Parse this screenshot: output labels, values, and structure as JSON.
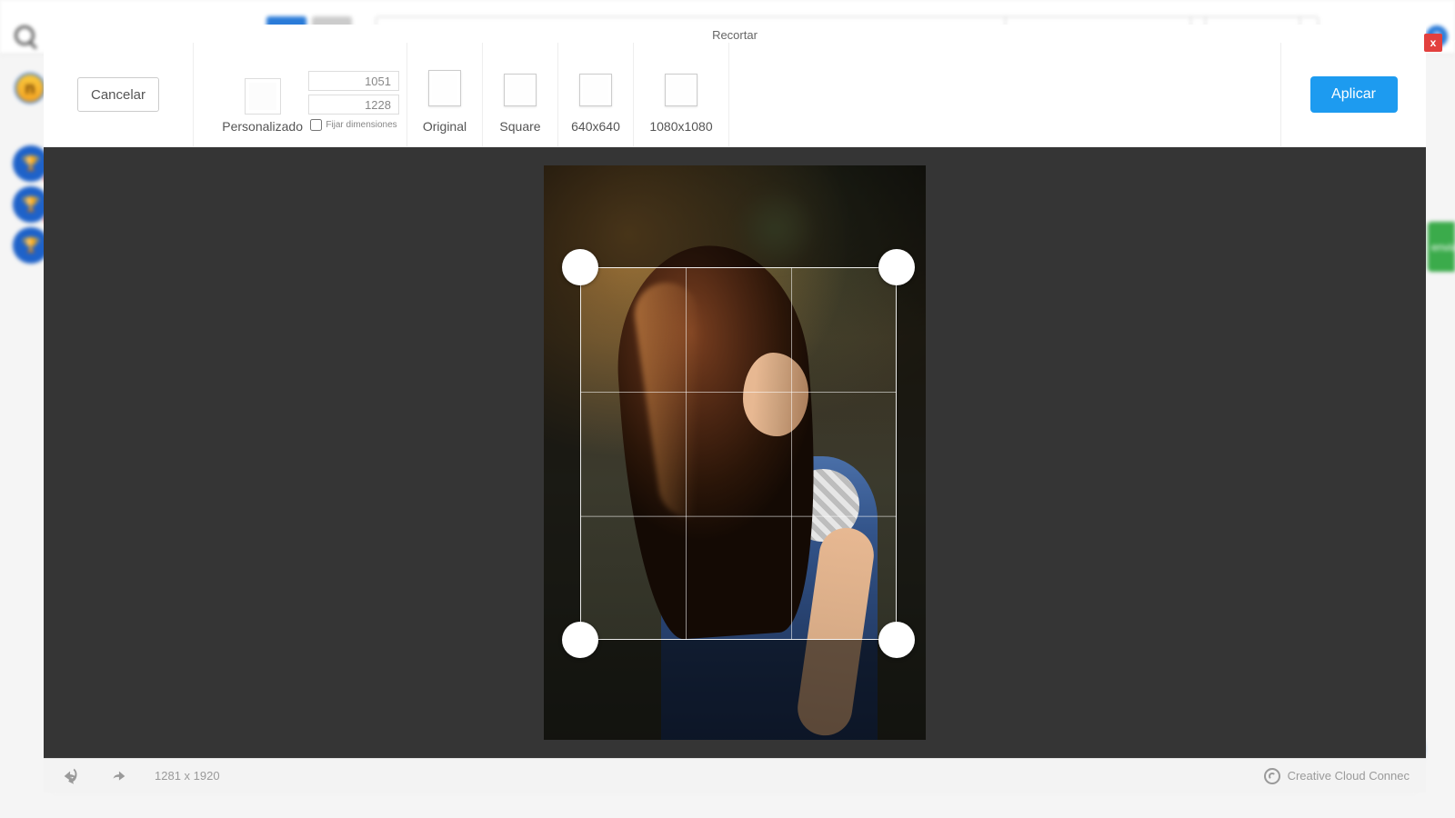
{
  "background": {
    "avatar_letter": "n",
    "help_symbol": "?",
    "send_label": "enviar"
  },
  "modal": {
    "title": "Recortar",
    "close_label": "x",
    "cancel_label": "Cancelar",
    "apply_label": "Aplicar",
    "custom": {
      "label": "Personalizado",
      "width_value": "1051",
      "height_value": "1228",
      "lock_label": "Fijar dimensiones"
    },
    "presets": {
      "original": "Original",
      "square": "Square",
      "p640": "640x640",
      "p1080": "1080x1080"
    }
  },
  "footer": {
    "dimensions": "1281 x 1920",
    "cc_label": "Creative Cloud Connec"
  }
}
